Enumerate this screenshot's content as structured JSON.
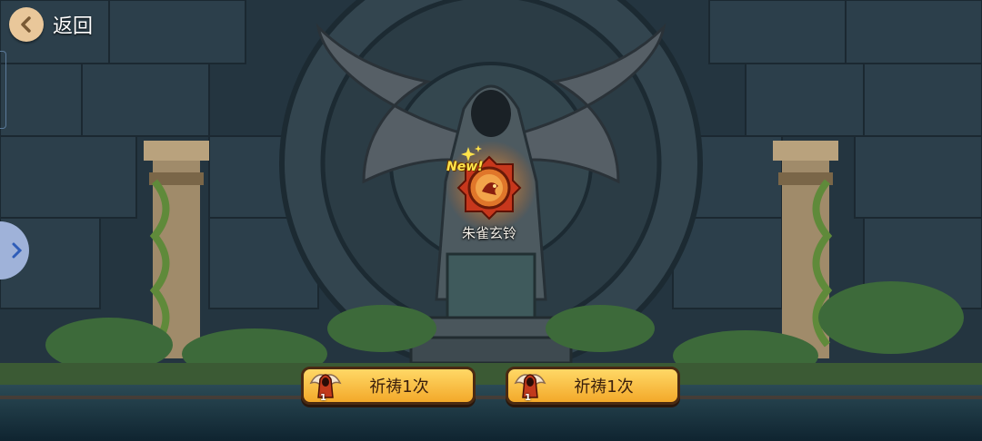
{
  "header": {
    "back_label": "返回"
  },
  "item": {
    "new_badge": "New!",
    "name": "朱雀玄铃"
  },
  "actions": [
    {
      "label": "祈祷1次",
      "cost": "1"
    },
    {
      "label": "祈祷1次",
      "cost": "1"
    }
  ],
  "colors": {
    "button_fill": "#f3a92a",
    "button_border": "#4a2a12",
    "back_circle": "#e9c79a",
    "side_tab": "#9fb2d9"
  }
}
